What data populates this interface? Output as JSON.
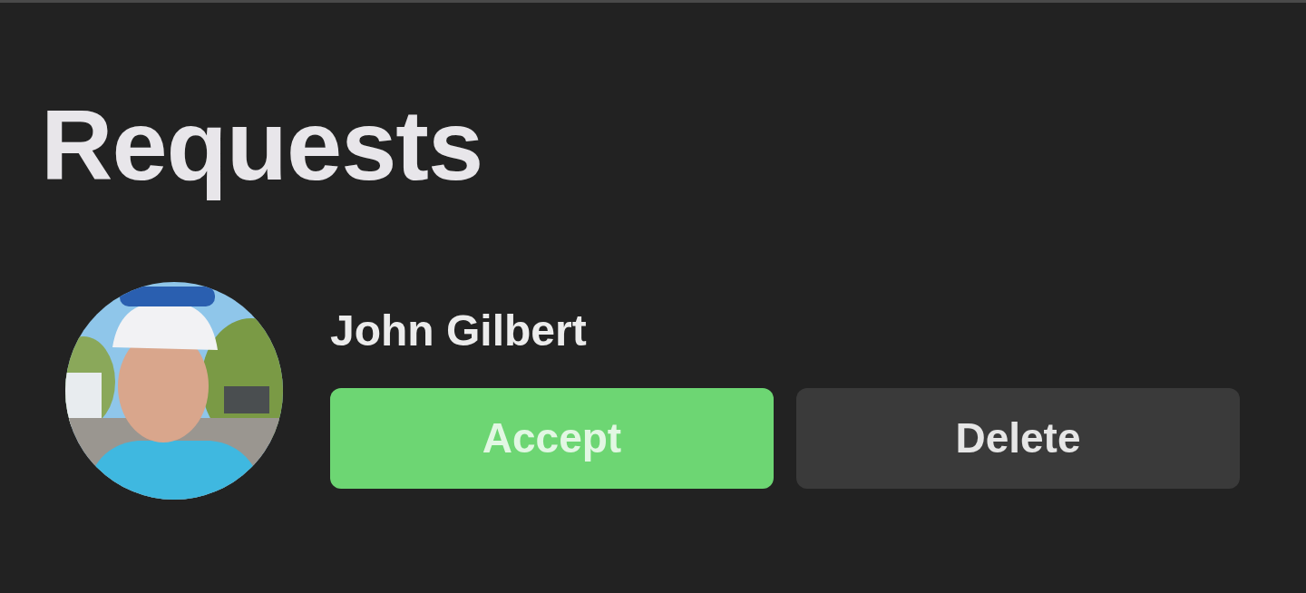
{
  "title": "Requests",
  "requests": [
    {
      "name": "John Gilbert",
      "actions": [
        {
          "label": "Accept",
          "kind": "primary"
        },
        {
          "label": "Delete",
          "kind": "secondary"
        }
      ]
    }
  ]
}
